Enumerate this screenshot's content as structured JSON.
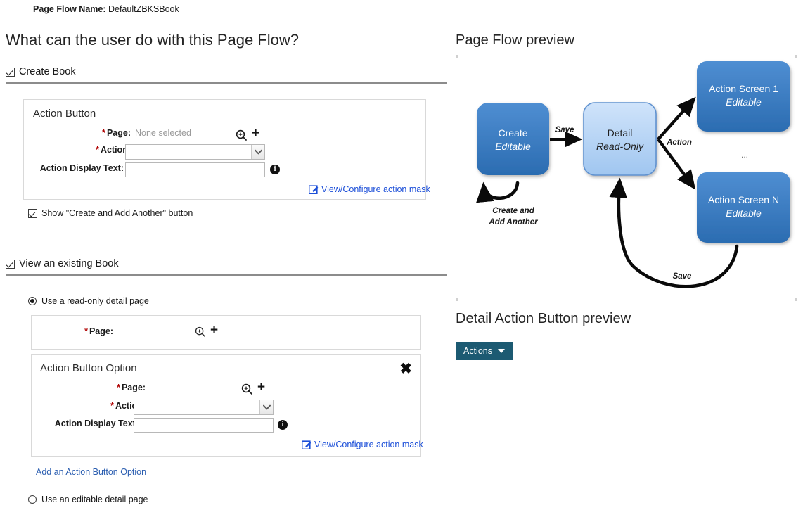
{
  "header": {
    "page_flow_name_label": "Page Flow Name:",
    "page_flow_name_value": "DefaultZBKSBook"
  },
  "left": {
    "question_title": "What can the user do with this Page Flow?",
    "create_section": {
      "checkbox_label": "Create Book",
      "checked": true,
      "panel_title": "Action Button",
      "page_label": "Page:",
      "page_value": "None selected",
      "action_label": "Action:",
      "action_value": "",
      "action_display_text_label": "Action Display Text:",
      "action_display_text_value": "",
      "mask_link": "View/Configure action mask",
      "show_add_another_label": "Show \"Create and Add Another\" button",
      "show_add_another_checked": true,
      "zoom_icon": "zoom-in-icon",
      "plus_icon": "plus-icon",
      "info_icon": "info-icon",
      "edit_icon": "edit-pencil-icon"
    },
    "view_section": {
      "checkbox_label": "View an existing Book",
      "checked": true,
      "radio_readonly_label": "Use a read-only detail page",
      "radio_readonly_selected": true,
      "radio_editable_label": "Use an editable detail page",
      "radio_editable_selected": false,
      "page_panel": {
        "page_label": "Page:",
        "page_value": ""
      },
      "option_panel": {
        "title": "Action Button Option",
        "close_icon": "close-icon",
        "page_label": "Page:",
        "page_value": "",
        "action_label": "Action:",
        "action_value": "",
        "action_display_text_label": "Action Display Text:",
        "action_display_text_value": "",
        "mask_link": "View/Configure action mask"
      },
      "add_option_link": "Add an Action Button Option"
    }
  },
  "right": {
    "preview_title": "Page Flow preview",
    "detail_preview_title": "Detail Action Button preview",
    "actions_button_label": "Actions",
    "actions_button_color": "#1c5a72",
    "caret_icon": "chevron-down-icon"
  },
  "diagram": {
    "nodes": [
      {
        "id": "create",
        "line1": "Create",
        "line2": "Editable",
        "style": "dark"
      },
      {
        "id": "detail",
        "line1": "Detail",
        "line2": "Read-Only",
        "style": "light"
      },
      {
        "id": "action1",
        "line1": "Action Screen 1",
        "line2": "Editable",
        "style": "dark"
      },
      {
        "id": "actionN",
        "line1": "Action Screen N",
        "line2": "Editable",
        "style": "dark"
      }
    ],
    "edges": [
      {
        "from": "create",
        "to": "detail",
        "label": "Save"
      },
      {
        "from": "create",
        "to": "create",
        "label": "Create and\nAdd Another",
        "label_line1": "Create and",
        "label_line2": "Add Another"
      },
      {
        "from": "detail",
        "to": "action1",
        "label": "Action"
      },
      {
        "from": "detail",
        "to": "actionN",
        "label": ""
      },
      {
        "from": "actionN",
        "to": "detail",
        "label": "Save"
      }
    ],
    "ellipsis": "...",
    "colors": {
      "dark_node_top": "#4a89ce",
      "dark_node_bottom": "#2a6bb0",
      "light_node_top": "#c3ddf7",
      "light_node_bottom": "#9cc4ef",
      "light_node_border": "#5f92d0",
      "edge": "#0a0a0a"
    }
  }
}
